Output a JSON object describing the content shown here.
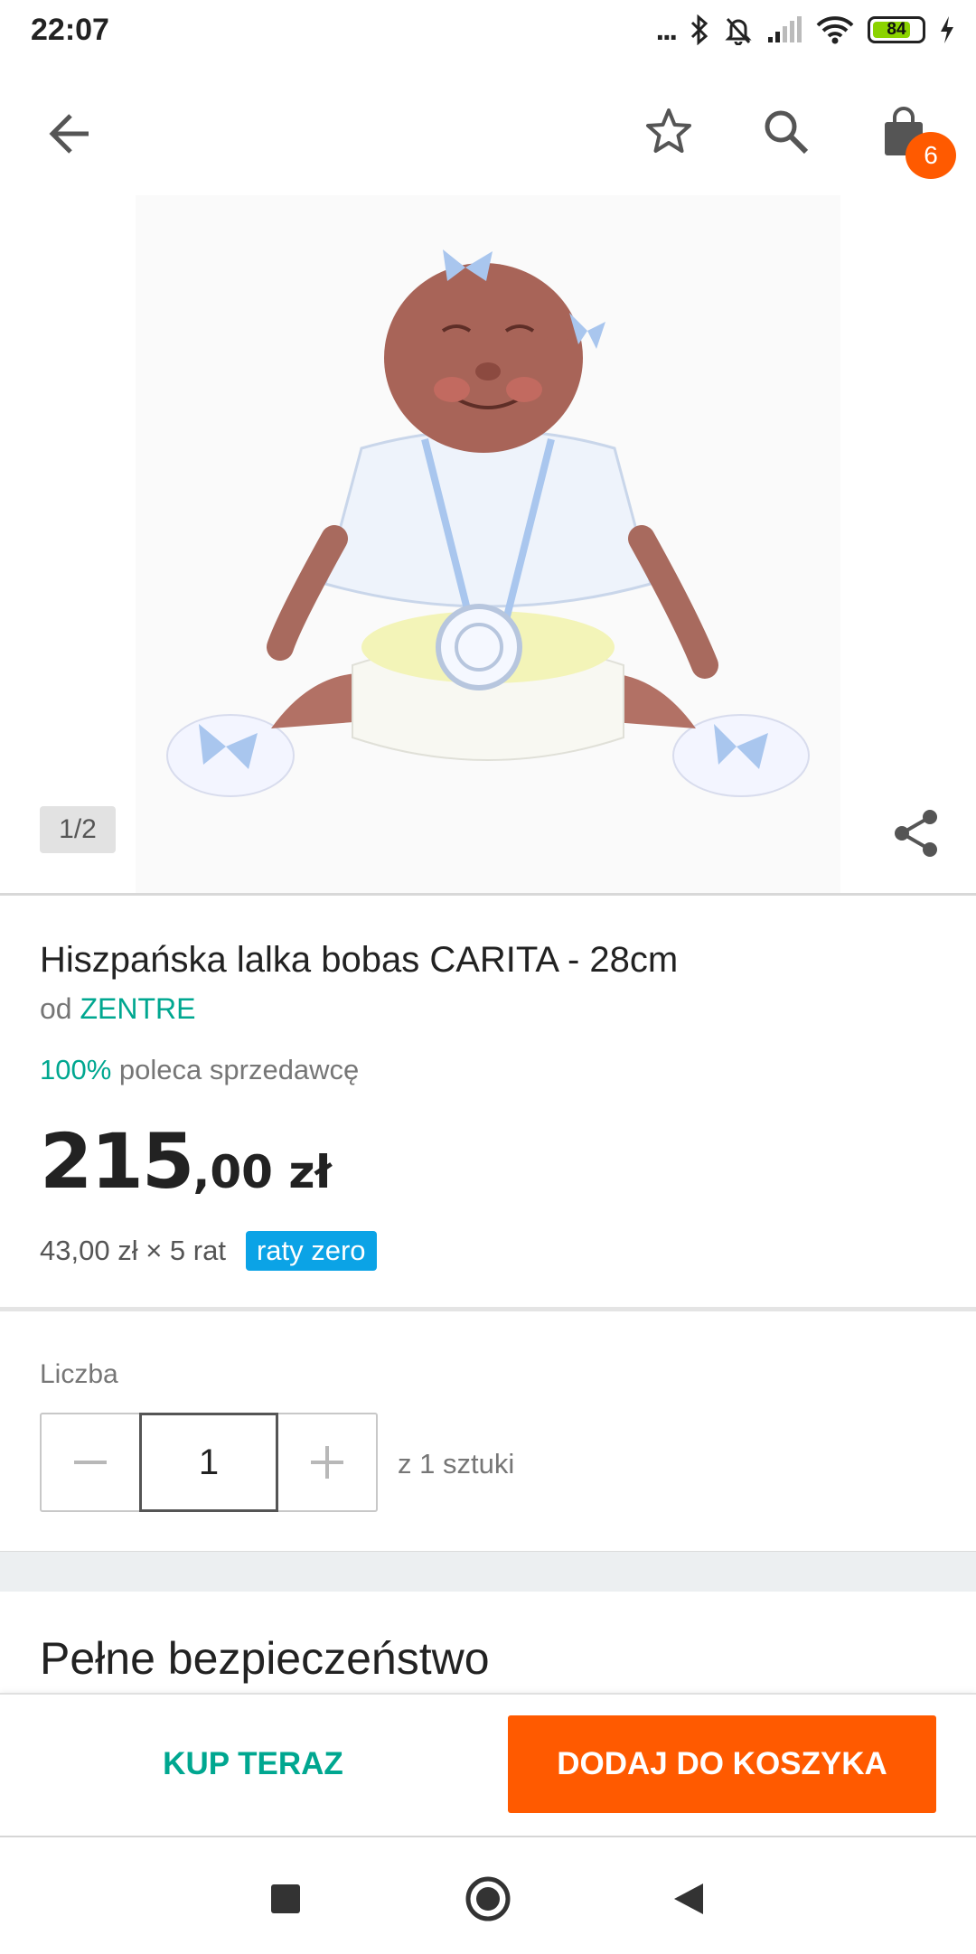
{
  "status_bar": {
    "time": "22:07",
    "dots": "...",
    "battery_level": "84",
    "icons": [
      "bluetooth-icon",
      "bell-off-icon",
      "signal-icon",
      "wifi-icon",
      "battery-icon",
      "charging-icon"
    ]
  },
  "app_bar": {
    "icons": [
      "back-arrow-icon",
      "star-icon",
      "search-icon",
      "shopping-bag-icon"
    ],
    "cart_count": "6"
  },
  "image": {
    "page_indicator": "1/2",
    "share_icon": "share-icon"
  },
  "product": {
    "title": "Hiszpańska lalka bobas CARITA - 28cm",
    "seller_prefix": "od",
    "seller_name": "ZENTRE",
    "recommend_pct": "100%",
    "recommend_text": "poleca sprzedawcę",
    "price_int": "215",
    "price_rest": ",00 zł",
    "installments_text": "43,00 zł × 5 rat",
    "installments_badge": "raty zero"
  },
  "quantity": {
    "label": "Liczba",
    "value": "1",
    "available": "z 1 sztuki"
  },
  "safety": {
    "heading": "Pełne bezpieczeństwo"
  },
  "actions": {
    "buy_now": "KUP TERAZ",
    "add_to_cart": "DODAJ DO KOSZYKA"
  },
  "colors": {
    "accent_orange": "#ff5a00",
    "accent_teal": "#00a790",
    "badge_blue": "#0ba3e6"
  }
}
